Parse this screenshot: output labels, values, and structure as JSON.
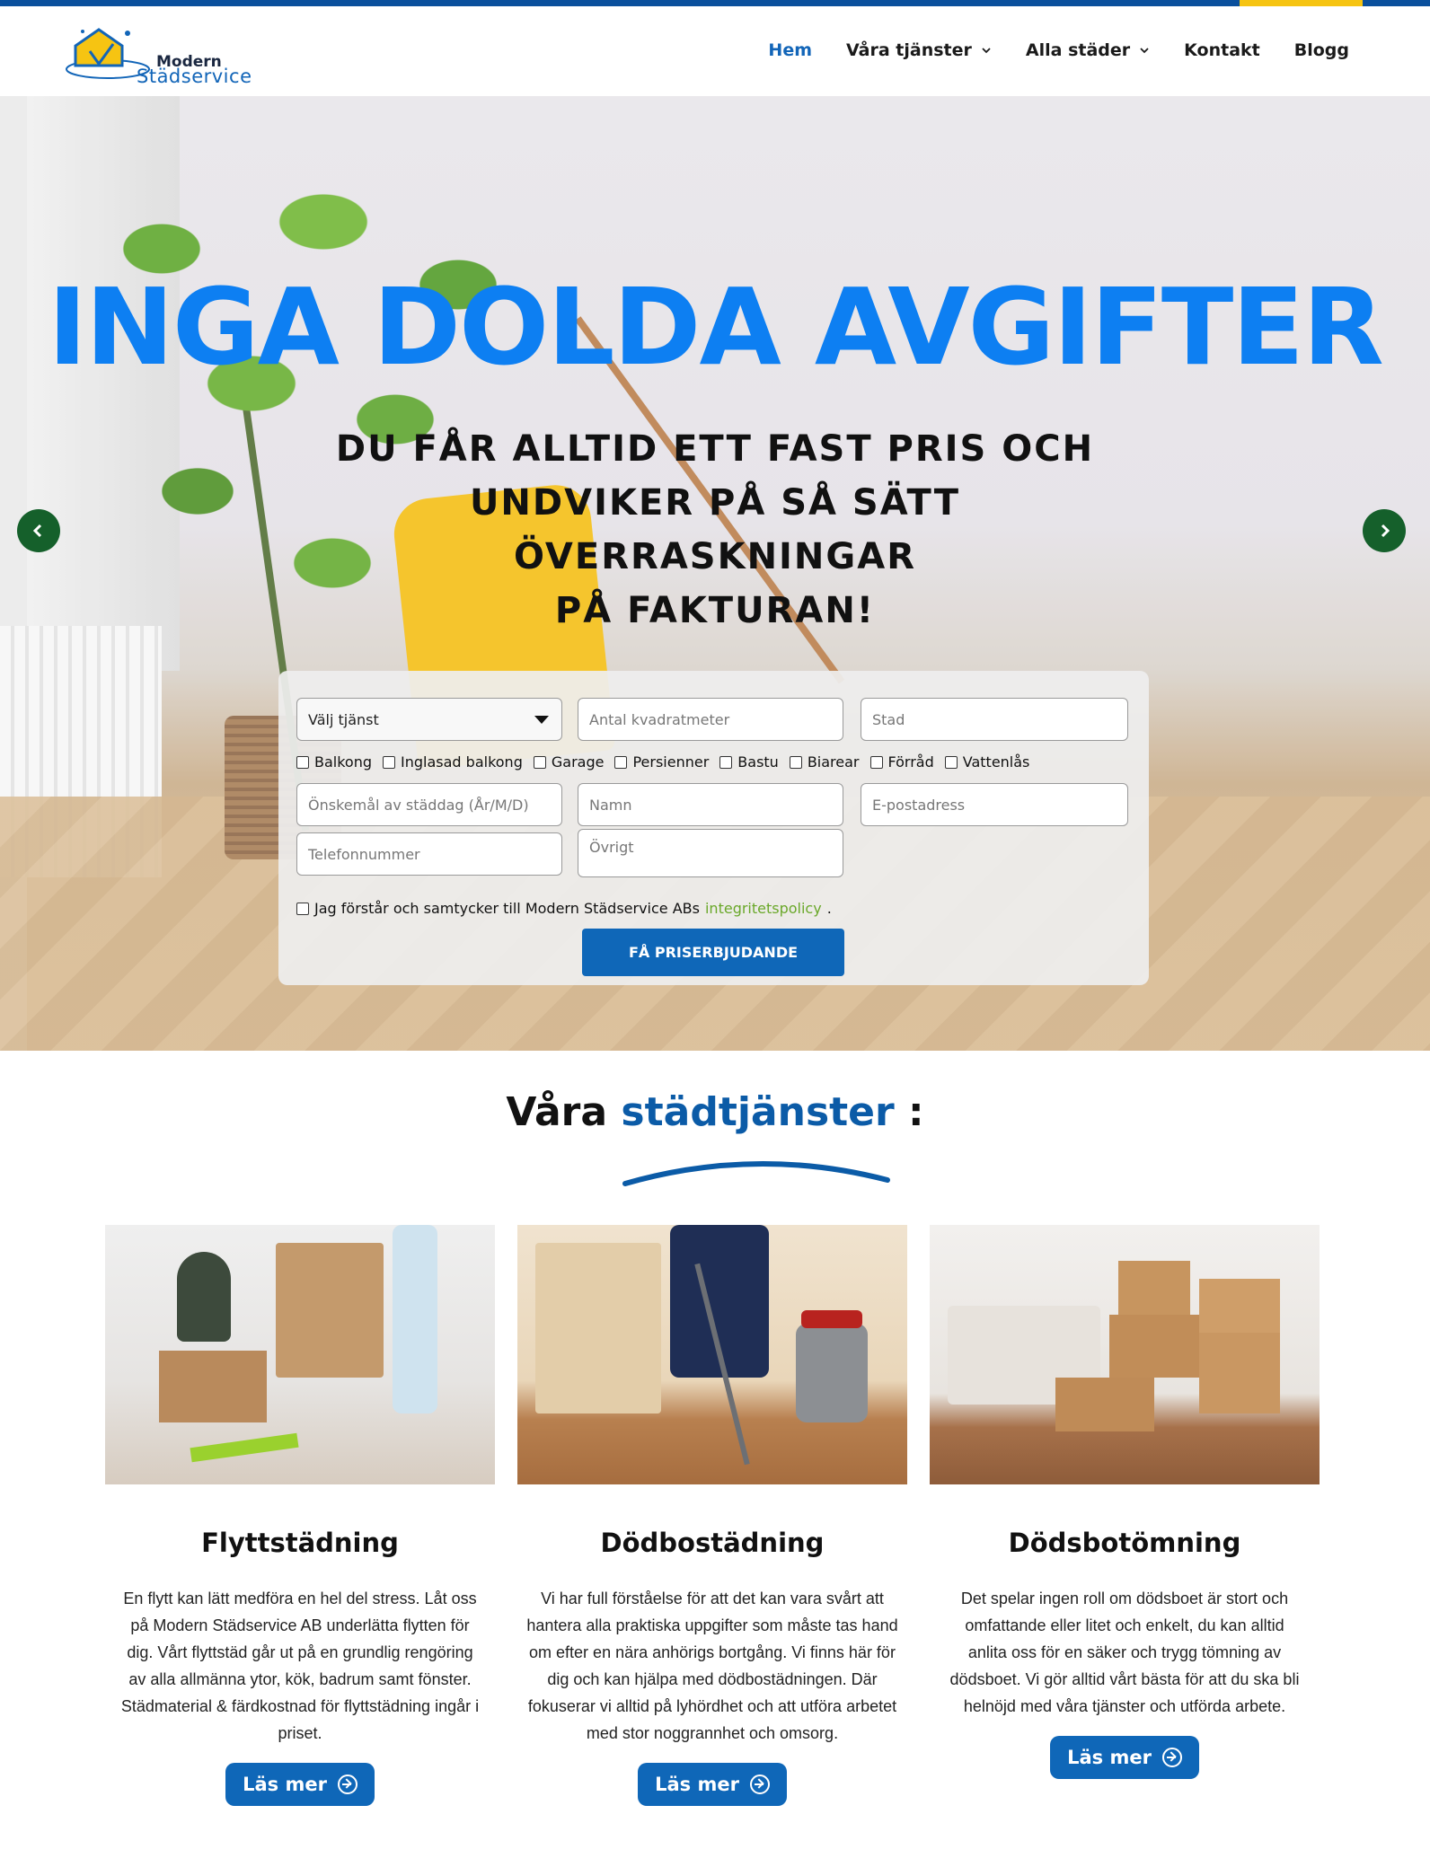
{
  "colors": {
    "brand_blue": "#0f67b8",
    "hero_title": "#0d7ff2",
    "top_bar": "#0a4f9c",
    "top_bar_accent": "#f6c412",
    "arrow_green": "#15602b",
    "link_green": "#6aa82a"
  },
  "logo": {
    "line1": "Modern",
    "line2": "Städservice",
    "icon": "house-cleaning-icon"
  },
  "nav": {
    "items": [
      {
        "label": "Hem",
        "active": true
      },
      {
        "label": "Våra tjänster",
        "dropdown": true
      },
      {
        "label": "Alla städer",
        "dropdown": true
      },
      {
        "label": "Kontakt"
      },
      {
        "label": "Blogg"
      }
    ]
  },
  "hero": {
    "title": "INGA DOLDA AVGIFTER",
    "subtitle_lines": [
      "DU FÅR ALLTID ETT FAST PRIS OCH",
      "UNDVIKER PÅ SÅ SÄTT ÖVERRASKNINGAR",
      "PÅ FAKTURAN!"
    ],
    "prev_icon": "chevron-left-icon",
    "next_icon": "chevron-right-icon"
  },
  "form": {
    "service_select": "Välj tjänst",
    "area_placeholder": "Antal kvadratmeter",
    "city_placeholder": "Stad",
    "checkboxes": [
      "Balkong",
      "Inglasad balkong",
      "Garage",
      "Persienner",
      "Bastu",
      "Biarear",
      "Förråd",
      "Vattenlås"
    ],
    "date_placeholder": "Önskemål av städdag (År/M/D)",
    "name_placeholder": "Namn",
    "email_placeholder": "E-postadress",
    "phone_placeholder": "Telefonnummer",
    "other_placeholder": "Övrigt",
    "consent_text": "Jag förstår och samtycker till Modern Städservice ABs",
    "consent_link": "integritetspolicy",
    "consent_end": ".",
    "submit_label": "FÅ PRISERBJUDANDE"
  },
  "services": {
    "title_part1": "Våra",
    "title_part2": "städtjänster",
    "title_part3": ":",
    "cards": [
      {
        "title": "Flyttstädning",
        "text": "En flytt kan lätt medföra en hel del stress. Låt oss på Modern Städservice AB underlätta flytten för dig. Vårt flyttstäd går ut på en grundlig rengöring av alla allmänna ytor, kök, badrum samt fönster. Städmaterial & färdkostnad för flyttstädning ingår i priset.",
        "button": "Läs mer"
      },
      {
        "title": "Dödbostädning",
        "text": "Vi har full förståelse för att det kan vara svårt att hantera alla praktiska uppgifter som måste tas hand om efter en nära anhörigs bortgång. Vi finns här för dig och kan hjälpa med dödbostädningen. Där fokuserar vi alltid på lyhördhet och att utföra arbetet med stor noggrannhet och omsorg.",
        "button": "Läs mer"
      },
      {
        "title": "Dödsbotömning",
        "text": "Det spelar ingen roll om dödsboet är stort och omfattande eller litet och enkelt, du kan alltid anlita oss för en säker och trygg tömning av dödsboet. Vi gör alltid vårt bästa för att du ska bli helnöjd med våra tjänster och utförda arbete.",
        "button": "Läs mer"
      }
    ]
  }
}
